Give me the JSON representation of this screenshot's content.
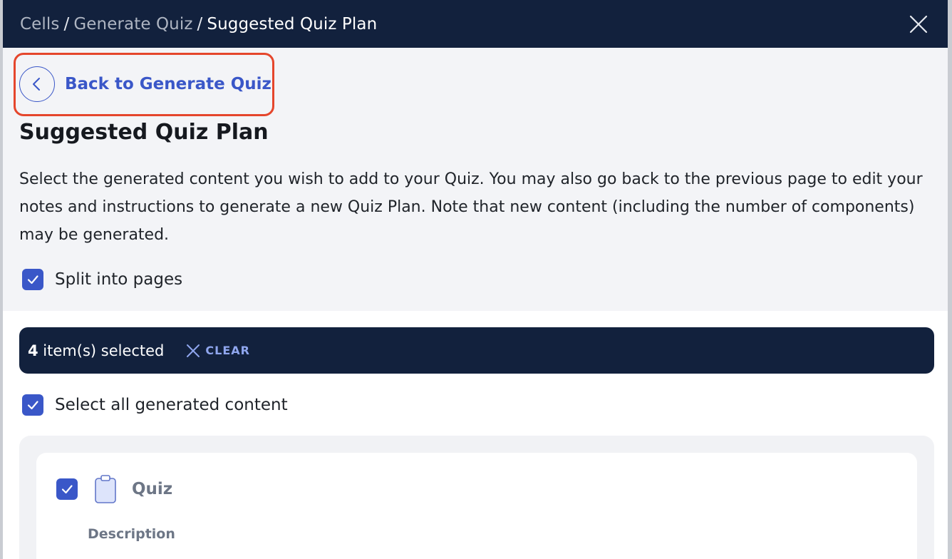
{
  "breadcrumb": {
    "items": [
      "Cells",
      "Generate Quiz",
      "Suggested Quiz Plan"
    ],
    "separator": "/"
  },
  "back_link": {
    "label": "Back to Generate Quiz"
  },
  "page": {
    "title": "Suggested Quiz Plan",
    "description": "Select the generated content you wish to add to your Quiz. You may also go back to the previous page to edit your notes and instructions to generate a new Quiz Plan. Note that new content (including the number of components) may be generated."
  },
  "split_into_pages": {
    "label": "Split into pages",
    "checked": true
  },
  "selection_bar": {
    "count": "4",
    "count_suffix": " item(s) selected",
    "clear_label": "CLEAR"
  },
  "select_all": {
    "label": "Select all generated content",
    "checked": true
  },
  "content_items": [
    {
      "title": "Quiz",
      "checked": true,
      "icon": "clipboard-icon",
      "description_label": "Description"
    }
  ],
  "colors": {
    "header_bg": "#12213d",
    "accent": "#3a57c8",
    "highlight_border": "#e5462c",
    "page_bg": "#f3f4f7"
  }
}
